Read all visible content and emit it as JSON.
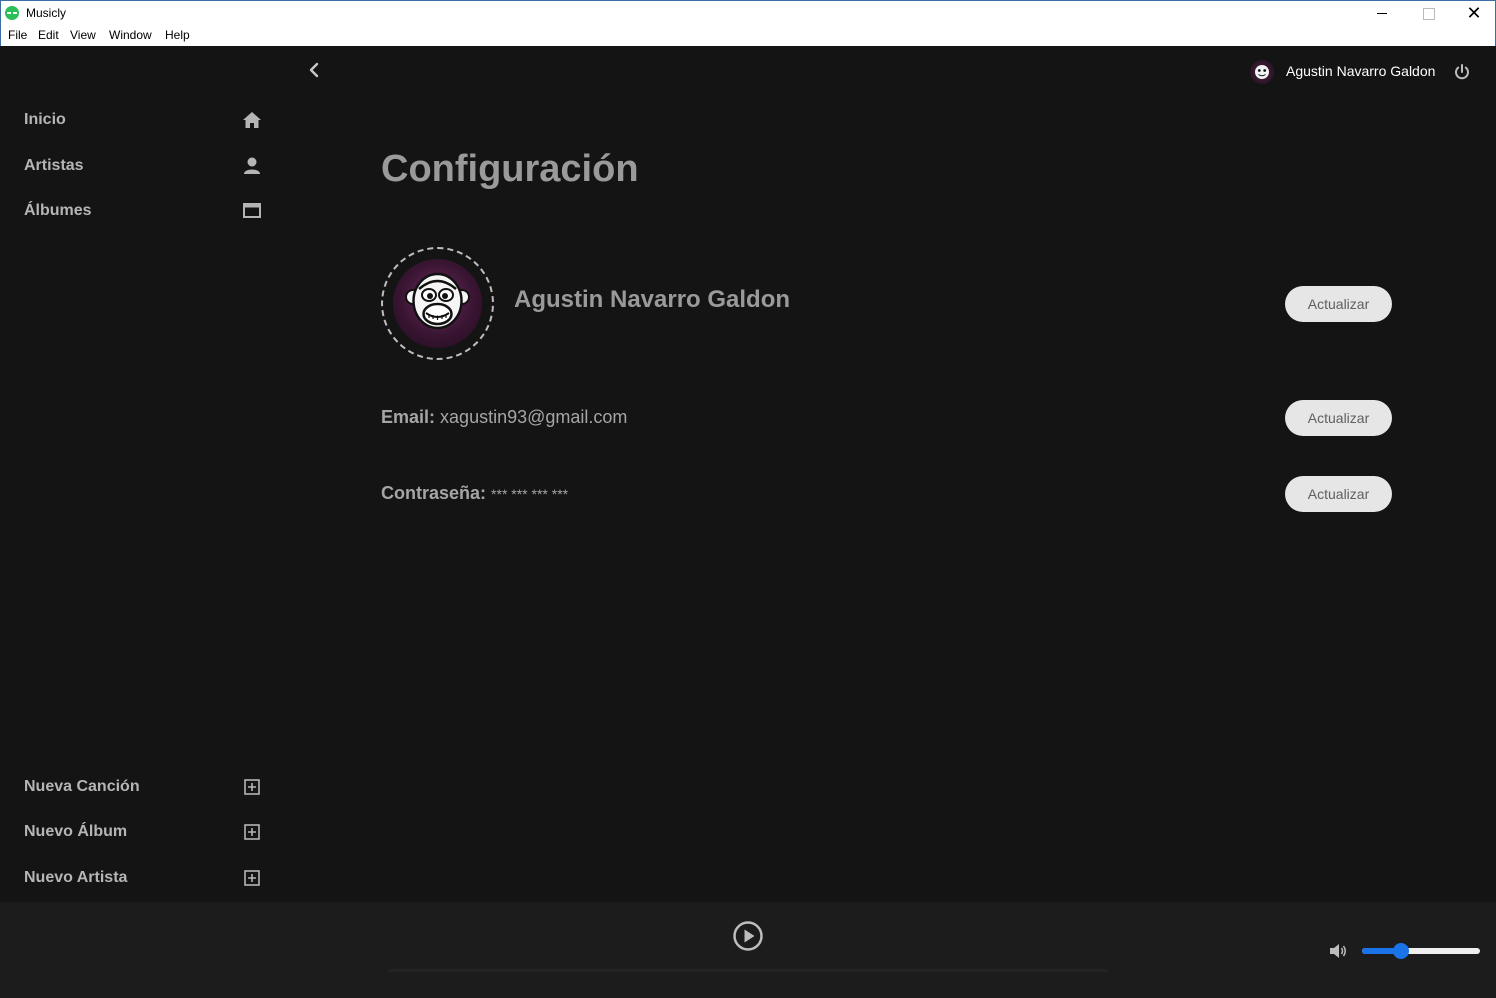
{
  "window": {
    "title": "Musicly",
    "menu": [
      "File",
      "Edit",
      "View",
      "Window",
      "Help"
    ]
  },
  "sidebar": {
    "nav": [
      {
        "label": "Inicio",
        "icon": "home-icon"
      },
      {
        "label": "Artistas",
        "icon": "user-icon"
      },
      {
        "label": "Álbumes",
        "icon": "album-icon"
      }
    ],
    "actions": [
      {
        "label": "Nueva Canción",
        "icon": "plus-square-icon"
      },
      {
        "label": "Nuevo Álbum",
        "icon": "plus-square-icon"
      },
      {
        "label": "Nuevo Artista",
        "icon": "plus-square-icon"
      }
    ]
  },
  "header": {
    "user_name": "Agustin Navarro Galdon"
  },
  "settings": {
    "title": "Configuración",
    "profile_name": "Agustin Navarro Galdon",
    "email_label": "Email:",
    "email_value": "xagustin93@gmail.com",
    "password_label": "Contraseña:",
    "password_value": "*** *** *** ***",
    "update_label": "Actualizar"
  },
  "player": {
    "progress": 0,
    "volume": 0.33
  },
  "colors": {
    "background": "#141414",
    "player_bar": "#1c1c1c",
    "accent": "#1a73e8",
    "text_muted": "#9a9a9a"
  }
}
